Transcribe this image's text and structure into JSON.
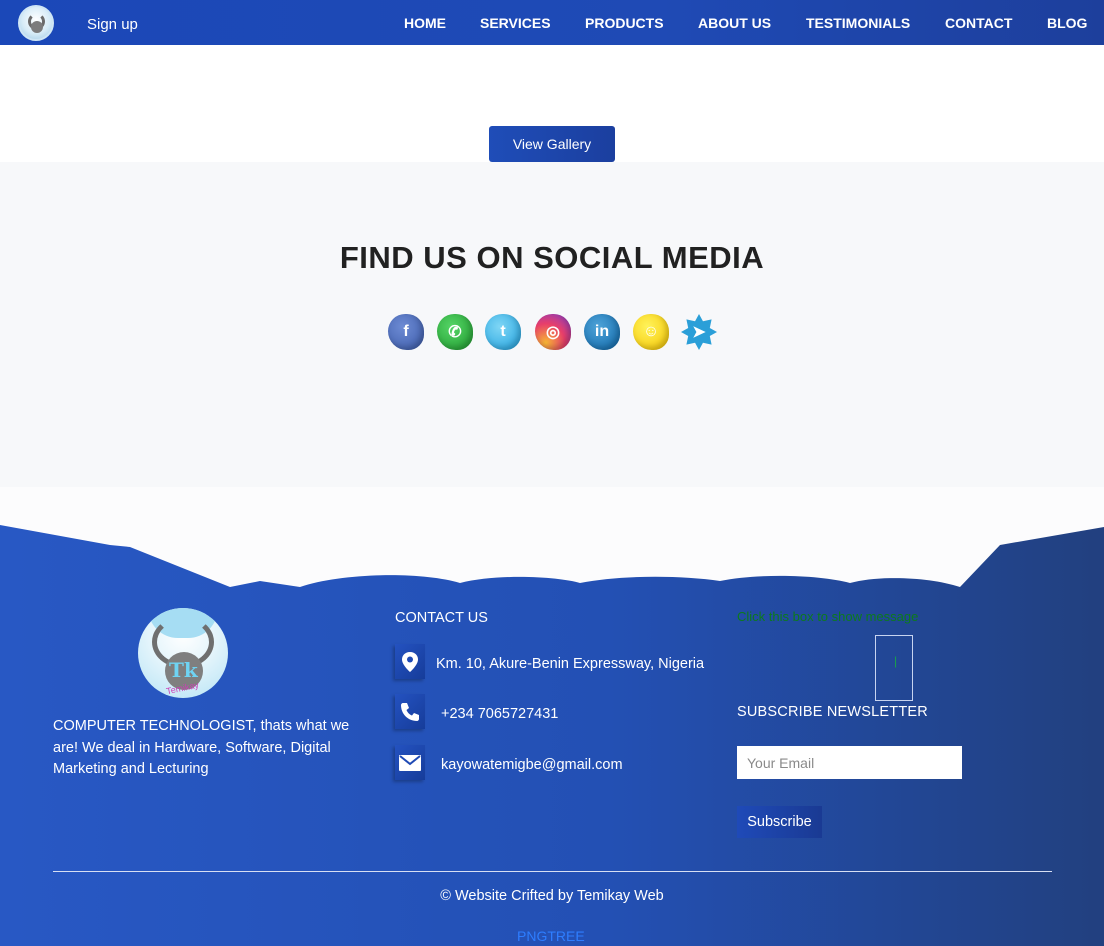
{
  "navbar": {
    "signup_label": "Sign up",
    "links": [
      "HOME",
      "SERVICES",
      "PRODUCTS",
      "ABOUT US",
      "TESTIMONIALS",
      "CONTACT",
      "BLOG"
    ]
  },
  "gallery": {
    "button_label": "View Gallery"
  },
  "social": {
    "title": "FIND US ON SOCIAL MEDIA",
    "icons": [
      {
        "name": "facebook-icon",
        "glyph": "f"
      },
      {
        "name": "whatsapp-icon",
        "glyph": "✆"
      },
      {
        "name": "twitter-icon",
        "glyph": "t"
      },
      {
        "name": "instagram-icon",
        "glyph": "◎"
      },
      {
        "name": "linkedin-icon",
        "glyph": "in"
      },
      {
        "name": "snapchat-icon",
        "glyph": "☺"
      },
      {
        "name": "telegram-icon",
        "glyph": "➤"
      }
    ]
  },
  "footer": {
    "logo_letters": "Tk",
    "logo_brand": "Temikay",
    "about_text": "COMPUTER TECHNOLOGIST, thats what we are! We deal in Hardware, Software, Digital Marketing and Lecturing",
    "contact_title": "CONTACT US",
    "address": "Km. 10, Akure-Benin Expressway, Nigeria",
    "phone": "+234 7065727431",
    "email": "kayowatemigbe@gmail.com",
    "message_toggle": "Click this box to show message",
    "message_box_char": "|",
    "subscribe_title": "SUBSCRIBE NEWSLETTER",
    "email_placeholder": "Your Email",
    "subscribe_label": "Subscribe",
    "copyright": "© Website Crifted by Temikay Web",
    "credit": "PNGTREE"
  },
  "colors": {
    "primary_blue": "#1f4ab5",
    "footer_blue_light": "#2656c2",
    "footer_blue_dark": "#243f85",
    "section_gray": "#f7f8fa"
  }
}
